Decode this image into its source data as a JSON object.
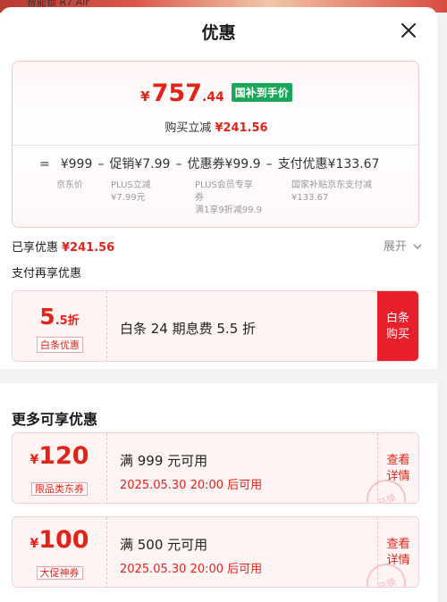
{
  "background": {
    "peek_text": "智能锁 R7 Air"
  },
  "header": {
    "title": "优惠",
    "close_icon": "close-icon"
  },
  "price_card": {
    "currency": "¥",
    "price_int": "757",
    "price_dec": ".44",
    "subsidy_tag": "国补到手价",
    "immediate_label": "购买立减",
    "immediate_amount": "¥241.56",
    "formula": {
      "equals": "=",
      "base": {
        "value": "¥999",
        "label": "京东价"
      },
      "items": [
        {
          "op": "–",
          "value": "促销¥7.99",
          "sub1": "PLUS立减",
          "sub2": "¥7.99元",
          "sub3": ""
        },
        {
          "op": "–",
          "value": "优惠券¥99.9",
          "sub1": "PLUS会员专享",
          "sub2": "券",
          "sub3": "满1享9折减99.9"
        },
        {
          "op": "–",
          "value": "支付优惠¥133.67",
          "sub1": "国家补贴京东支付减",
          "sub2": "¥133.67",
          "sub3": ""
        }
      ]
    }
  },
  "enjoyed": {
    "label": "已享优惠",
    "amount": "¥241.56",
    "expand_label": "展开"
  },
  "pay_again": {
    "title": "支付再享优惠"
  },
  "payment_coupon": {
    "rate_main": "5",
    "rate_sub": ".5折",
    "badge": "白条优惠",
    "description": "白条 24 期息费 5.5 折",
    "button_line1": "白条",
    "button_line2": "购买"
  },
  "more": {
    "title": "更多可享优惠",
    "coupons": [
      {
        "currency": "¥",
        "amount": "120",
        "badge": "限品类东券",
        "condition": "满 999 元可用",
        "date": "2025.05.30  20:00 后可用",
        "btn1": "查看",
        "btn2": "详情",
        "stamp": "已领"
      },
      {
        "currency": "¥",
        "amount": "100",
        "badge": "大促神券",
        "condition": "满 500 元可用",
        "date": "2025.05.30  20:00 后可用",
        "btn1": "查看",
        "btn2": "详情",
        "stamp": "已领"
      }
    ]
  },
  "colors": {
    "accent_red": "#e2231a",
    "subsidy_green": "#19a85a"
  }
}
